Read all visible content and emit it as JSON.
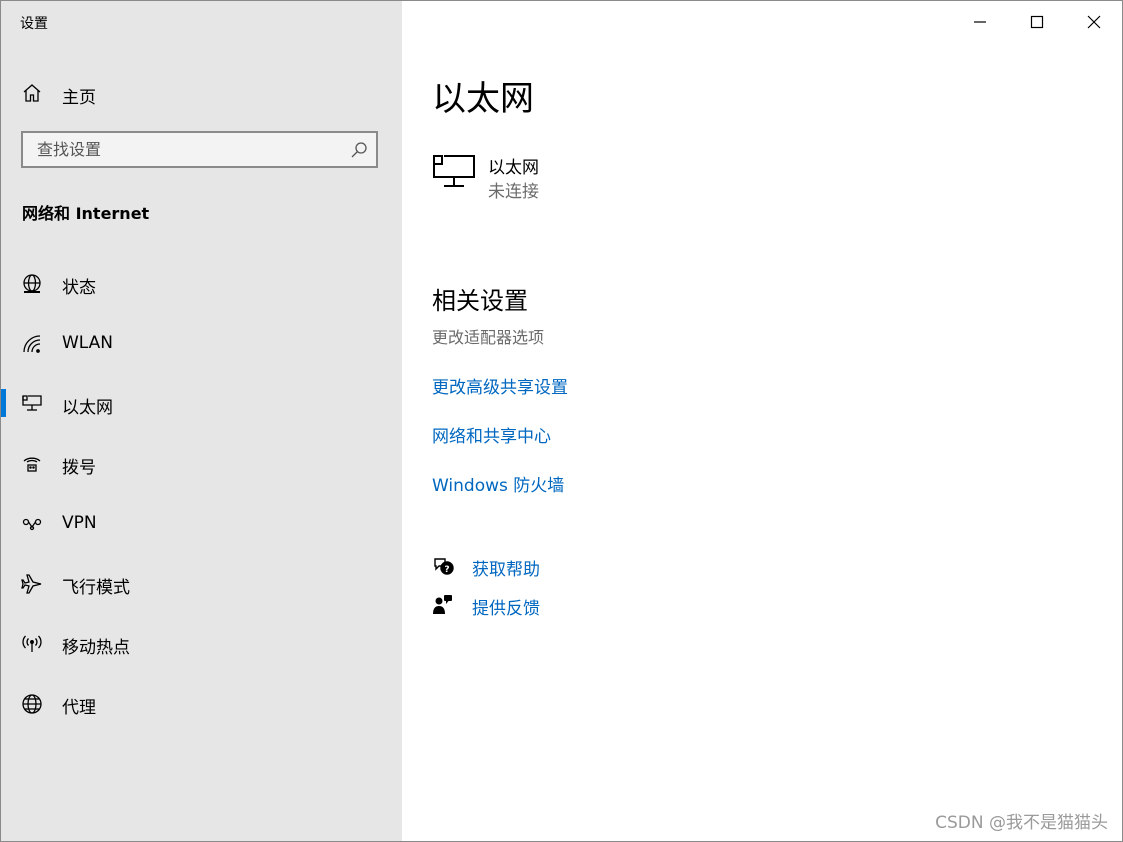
{
  "app": {
    "title": "设置"
  },
  "sidebar": {
    "home_label": "主页",
    "search_placeholder": "查找设置",
    "section_title": "网络和 Internet",
    "items": [
      {
        "label": "状态",
        "icon": "globe-status-icon"
      },
      {
        "label": "WLAN",
        "icon": "wifi-icon"
      },
      {
        "label": "以太网",
        "icon": "ethernet-icon",
        "active": true
      },
      {
        "label": "拨号",
        "icon": "dialup-icon"
      },
      {
        "label": "VPN",
        "icon": "vpn-icon"
      },
      {
        "label": "飞行模式",
        "icon": "airplane-icon"
      },
      {
        "label": "移动热点",
        "icon": "hotspot-icon"
      },
      {
        "label": "代理",
        "icon": "globe-icon"
      }
    ]
  },
  "main": {
    "title": "以太网",
    "device": {
      "name": "以太网",
      "status": "未连接"
    },
    "related_title": "相关设置",
    "related_plain": "更改适配器选项",
    "links": [
      "更改高级共享设置",
      "网络和共享中心",
      "Windows 防火墙"
    ],
    "help": {
      "get_help": "获取帮助",
      "feedback": "提供反馈"
    }
  },
  "watermark": "CSDN @我不是猫猫头",
  "colors": {
    "accent": "#0078d7",
    "link": "#0067c0",
    "sidebar_bg": "#e6e6e6"
  }
}
